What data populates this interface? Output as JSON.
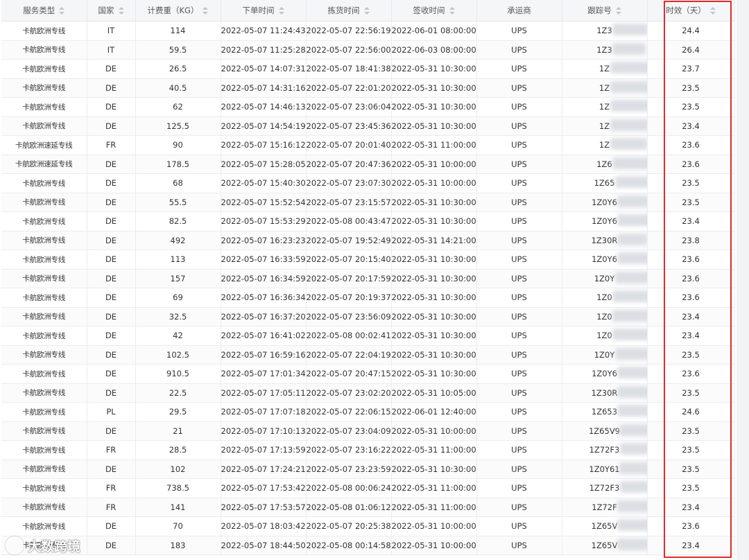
{
  "columns": [
    {
      "label": "服务类型",
      "sortable": true
    },
    {
      "label": "国家",
      "sortable": true
    },
    {
      "label": "计费重（KG）",
      "sortable": true
    },
    {
      "label": "下单时间",
      "sortable": true
    },
    {
      "label": "拣货时间",
      "sortable": true
    },
    {
      "label": "签收时间",
      "sortable": true
    },
    {
      "label": "承运商",
      "sortable": false
    },
    {
      "label": "跟踪号",
      "sortable": true
    },
    {
      "label": "时效（天）",
      "sortable": true
    }
  ],
  "rows": [
    {
      "service": "卡航欧洲专线",
      "country": "IT",
      "weight": "114",
      "order_time": "2022-05-07 11:24:43",
      "pick_time": "2022-05-07 22:56:19",
      "sign_time": "2022-06-01 08:00:00",
      "carrier": "UPS",
      "tracking": "1Z3",
      "days": "24.4"
    },
    {
      "service": "卡航欧洲专线",
      "country": "IT",
      "weight": "59.5",
      "order_time": "2022-05-07 11:25:28",
      "pick_time": "2022-05-07 22:56:00",
      "sign_time": "2022-06-03 08:00:00",
      "carrier": "UPS",
      "tracking": "1Z3",
      "days": "26.4"
    },
    {
      "service": "卡航欧洲专线",
      "country": "DE",
      "weight": "26.5",
      "order_time": "2022-05-07 14:07:31",
      "pick_time": "2022-05-07 18:41:38",
      "sign_time": "2022-05-31 10:30:00",
      "carrier": "UPS",
      "tracking": "1Z",
      "days": "23.7"
    },
    {
      "service": "卡航欧洲专线",
      "country": "DE",
      "weight": "40.5",
      "order_time": "2022-05-07 14:31:16",
      "pick_time": "2022-05-07 22:01:20",
      "sign_time": "2022-05-31 10:30:00",
      "carrier": "UPS",
      "tracking": "1Z",
      "days": "23.5"
    },
    {
      "service": "卡航欧洲专线",
      "country": "DE",
      "weight": "62",
      "order_time": "2022-05-07 14:46:13",
      "pick_time": "2022-05-07 23:06:04",
      "sign_time": "2022-05-31 10:30:00",
      "carrier": "UPS",
      "tracking": "1Z",
      "days": "23.5"
    },
    {
      "service": "卡航欧洲专线",
      "country": "DE",
      "weight": "125.5",
      "order_time": "2022-05-07 14:54:19",
      "pick_time": "2022-05-07 23:45:36",
      "sign_time": "2022-05-31 10:30:00",
      "carrier": "UPS",
      "tracking": "1Z",
      "days": "23.4"
    },
    {
      "service": "卡航欧洲速延专线",
      "country": "FR",
      "weight": "90",
      "order_time": "2022-05-07 15:16:12",
      "pick_time": "2022-05-07 20:01:40",
      "sign_time": "2022-05-31 11:00:00",
      "carrier": "UPS",
      "tracking": "1Z",
      "days": "23.6"
    },
    {
      "service": "卡航欧洲速延专线",
      "country": "DE",
      "weight": "178.5",
      "order_time": "2022-05-07 15:28:05",
      "pick_time": "2022-05-07 20:47:36",
      "sign_time": "2022-05-31 10:00:00",
      "carrier": "UPS",
      "tracking": "1Z6",
      "days": "23.6"
    },
    {
      "service": "卡航欧洲专线",
      "country": "DE",
      "weight": "68",
      "order_time": "2022-05-07 15:40:30",
      "pick_time": "2022-05-07 23:07:30",
      "sign_time": "2022-05-31 10:00:00",
      "carrier": "UPS",
      "tracking": "1Z65",
      "days": "23.5"
    },
    {
      "service": "卡航欧洲专线",
      "country": "DE",
      "weight": "55.5",
      "order_time": "2022-05-07 15:52:54",
      "pick_time": "2022-05-07 23:15:57",
      "sign_time": "2022-05-31 10:30:00",
      "carrier": "UPS",
      "tracking": "1Z0Y6",
      "days": "23.5"
    },
    {
      "service": "卡航欧洲专线",
      "country": "DE",
      "weight": "82.5",
      "order_time": "2022-05-07 15:53:29",
      "pick_time": "2022-05-08 00:43:47",
      "sign_time": "2022-05-31 10:30:00",
      "carrier": "UPS",
      "tracking": "1Z0Y6",
      "days": "23.4"
    },
    {
      "service": "卡航欧洲专线",
      "country": "DE",
      "weight": "492",
      "order_time": "2022-05-07 16:23:23",
      "pick_time": "2022-05-07 19:52:49",
      "sign_time": "2022-05-31 14:21:00",
      "carrier": "UPS",
      "tracking": "1Z30R",
      "days": "23.8"
    },
    {
      "service": "卡航欧洲专线",
      "country": "DE",
      "weight": "113",
      "order_time": "2022-05-07 16:33:59",
      "pick_time": "2022-05-07 20:15:40",
      "sign_time": "2022-05-31 10:30:00",
      "carrier": "UPS",
      "tracking": "1Z0Y6",
      "days": "23.6"
    },
    {
      "service": "卡航欧洲专线",
      "country": "DE",
      "weight": "157",
      "order_time": "2022-05-07 16:34:59",
      "pick_time": "2022-05-07 20:17:59",
      "sign_time": "2022-05-31 10:30:00",
      "carrier": "UPS",
      "tracking": "1Z0Y",
      "days": "23.6"
    },
    {
      "service": "卡航欧洲专线",
      "country": "DE",
      "weight": "69",
      "order_time": "2022-05-07 16:36:34",
      "pick_time": "2022-05-07 20:19:37",
      "sign_time": "2022-05-31 10:30:00",
      "carrier": "UPS",
      "tracking": "1Z0",
      "days": "23.6"
    },
    {
      "service": "卡航欧洲专线",
      "country": "DE",
      "weight": "32.5",
      "order_time": "2022-05-07 16:37:20",
      "pick_time": "2022-05-07 23:56:09",
      "sign_time": "2022-05-31 10:30:00",
      "carrier": "UPS",
      "tracking": "1Z0",
      "days": "23.4"
    },
    {
      "service": "卡航欧洲专线",
      "country": "DE",
      "weight": "42",
      "order_time": "2022-05-07 16:41:02",
      "pick_time": "2022-05-08 00:02:41",
      "sign_time": "2022-05-31 10:30:00",
      "carrier": "UPS",
      "tracking": "1Z0",
      "days": "23.4"
    },
    {
      "service": "卡航欧洲专线",
      "country": "DE",
      "weight": "102.5",
      "order_time": "2022-05-07 16:59:16",
      "pick_time": "2022-05-07 22:04:19",
      "sign_time": "2022-05-31 10:30:00",
      "carrier": "UPS",
      "tracking": "1Z0Y",
      "days": "23.5"
    },
    {
      "service": "卡航欧洲专线",
      "country": "DE",
      "weight": "910.5",
      "order_time": "2022-05-07 17:01:34",
      "pick_time": "2022-05-07 20:47:15",
      "sign_time": "2022-05-31 10:30:00",
      "carrier": "UPS",
      "tracking": "1Z0Y6",
      "days": "23.6"
    },
    {
      "service": "卡航欧洲专线",
      "country": "DE",
      "weight": "22.5",
      "order_time": "2022-05-07 17:05:11",
      "pick_time": "2022-05-07 23:02:20",
      "sign_time": "2022-05-31 10:05:00",
      "carrier": "UPS",
      "tracking": "1Z30R",
      "days": "23.5"
    },
    {
      "service": "卡航欧洲专线",
      "country": "PL",
      "weight": "29.5",
      "order_time": "2022-05-07 17:07:18",
      "pick_time": "2022-05-07 22:06:15",
      "sign_time": "2022-06-01 12:40:00",
      "carrier": "UPS",
      "tracking": "1Z653",
      "days": "24.6"
    },
    {
      "service": "卡航欧洲专线",
      "country": "DE",
      "weight": "21",
      "order_time": "2022-05-07 17:10:13",
      "pick_time": "2022-05-07 23:04:09",
      "sign_time": "2022-05-31 10:00:00",
      "carrier": "UPS",
      "tracking": "1Z65V9",
      "days": "23.5"
    },
    {
      "service": "卡航欧洲专线",
      "country": "FR",
      "weight": "28.5",
      "order_time": "2022-05-07 17:13:59",
      "pick_time": "2022-05-07 23:16:22",
      "sign_time": "2022-05-31 11:00:00",
      "carrier": "UPS",
      "tracking": "1Z72F3",
      "days": "23.5"
    },
    {
      "service": "卡航欧洲专线",
      "country": "DE",
      "weight": "102",
      "order_time": "2022-05-07 17:24:21",
      "pick_time": "2022-05-07 23:23:59",
      "sign_time": "2022-05-31 10:30:00",
      "carrier": "UPS",
      "tracking": "1Z0Y61",
      "days": "23.5"
    },
    {
      "service": "卡航欧洲专线",
      "country": "FR",
      "weight": "738.5",
      "order_time": "2022-05-07 17:53:42",
      "pick_time": "2022-05-08 00:06:24",
      "sign_time": "2022-05-31 11:00:00",
      "carrier": "UPS",
      "tracking": "1Z72F3",
      "days": "23.5"
    },
    {
      "service": "卡航欧洲专线",
      "country": "FR",
      "weight": "141",
      "order_time": "2022-05-07 17:53:57",
      "pick_time": "2022-05-08 01:06:12",
      "sign_time": "2022-05-31 11:00:00",
      "carrier": "UPS",
      "tracking": "1Z72F",
      "days": "23.4"
    },
    {
      "service": "卡航欧洲专线",
      "country": "DE",
      "weight": "70",
      "order_time": "2022-05-07 18:03:42",
      "pick_time": "2022-05-07 20:25:38",
      "sign_time": "2022-05-31 10:00:00",
      "carrier": "UPS",
      "tracking": "1Z65V",
      "days": "23.6"
    },
    {
      "service": "卡航欧洲专线",
      "country": "DE",
      "weight": "183",
      "order_time": "2022-05-07 18:44:50",
      "pick_time": "2022-05-08 00:14:58",
      "sign_time": "2022-05-31 10:00:00",
      "carrier": "UPS",
      "tracking": "1Z65V",
      "days": "23.4"
    }
  ],
  "watermark": {
    "text": "大数跨境"
  },
  "highlight": {
    "column": "时效（天）",
    "color": "#e02a2a"
  },
  "icons": {
    "sort": "sort-icon"
  }
}
